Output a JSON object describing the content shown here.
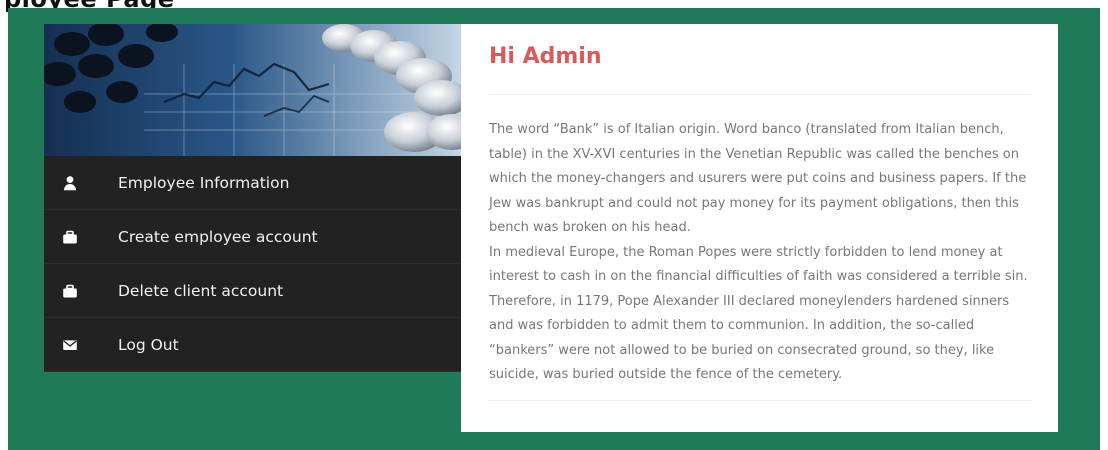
{
  "page": {
    "partial_heading": "ployee Page"
  },
  "sidebar": {
    "banner": {
      "icon": "finance-banner-image"
    },
    "items": [
      {
        "label": "Employee Information",
        "icon": "user-icon"
      },
      {
        "label": "Create employee account",
        "icon": "briefcase-icon"
      },
      {
        "label": "Delete client account",
        "icon": "briefcase-icon"
      },
      {
        "label": "Log Out",
        "icon": "envelope-icon"
      }
    ]
  },
  "content": {
    "greeting": "Hi Admin",
    "paragraphs": [
      "The word “Bank” is of Italian origin. Word banco (translated from Italian bench, table) in the XV-XVI centuries in the Venetian Republic was called the benches on which the money-changers and usurers were put coins and business papers. If the Jew was bankrupt and could not pay money for its payment obligations, then this bench was broken on his head.",
      "In medieval Europe, the Roman Popes were strictly forbidden to lend money at interest to cash in on the financial difficulties of faith was considered a terrible sin. Therefore, in 1179, Pope Alexander III declared moneylenders hardened sinners and was forbidden to admit them to communion. In addition, the so-called “bankers” were not allowed to be buried on consecrated ground, so they, like suicide, was buried outside the fence of the cemetery."
    ]
  },
  "colors": {
    "background_green": "#1f7a57",
    "sidebar_dark": "#222222",
    "greeting_red": "#d85a5a",
    "body_text_gray": "#777777"
  }
}
